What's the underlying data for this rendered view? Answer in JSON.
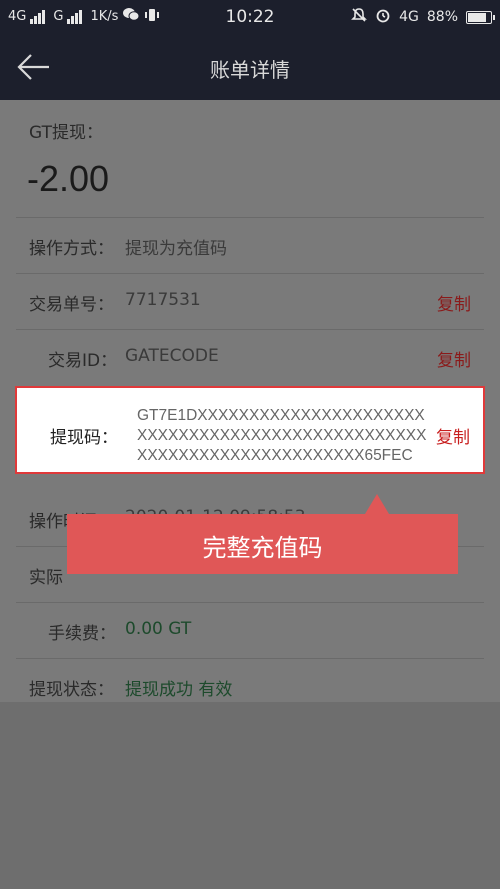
{
  "status_bar": {
    "net1": "4G",
    "net2": "G",
    "speed": "1K/s",
    "time": "10:22",
    "net_right": "4G",
    "battery": "88%",
    "battery_level": 0.88
  },
  "nav": {
    "title": "账单详情"
  },
  "detail": {
    "type_label": "GT提现：",
    "amount": "-2.00",
    "rows": [
      {
        "label": "操作方式：",
        "value": "提现为充值码"
      },
      {
        "label": "交易单号：",
        "value": "7717531",
        "copy": "复制"
      },
      {
        "label": "交易ID：",
        "value": "GATECODE",
        "copy": "复制"
      },
      {
        "label": "提现码：",
        "value": "GT7E1DXXXXXXXXXXXXXXXXXXXXXXXXXXXXXXXXXXXXXXXXXXXXXXXXXXXXXXXXXXXXXXXXXXXXXXXX65FEC",
        "copy": "复制"
      },
      {
        "label": "操作时间：",
        "value": "2020-01-12 09:58:53"
      },
      {
        "label": "实际"
      },
      {
        "label": "手续费：",
        "value": "0.00 GT"
      },
      {
        "label": "提现状态：",
        "value": "提现成功 有效"
      }
    ]
  },
  "callout": {
    "text": "完整充值码"
  },
  "colors": {
    "accent": "#e0393a",
    "callout": "#e05757",
    "navbar": "#1c1f2c"
  }
}
